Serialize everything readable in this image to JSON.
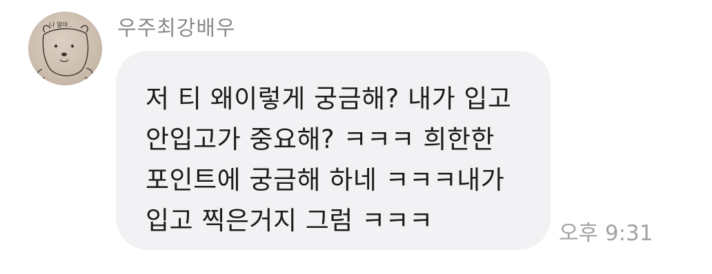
{
  "message": {
    "sender_name": "우주최강배우",
    "avatar": "bear-doodle-avatar",
    "avatar_sketch_text": "나 알아..",
    "lines": [
      "저 티 왜이렇게 궁금해? 내가 입고",
      "안입고가 중요해? ㅋㅋㅋ 희한한",
      "포인트에 궁금해 하네 ㅋㅋㅋ내가",
      "입고 찍은거지 그럼 ㅋㅋㅋ"
    ],
    "timestamp": "오후 9:31"
  },
  "colors": {
    "background": "#ffffff",
    "bubble": "#f2f2f4",
    "text": "#1b1b1b",
    "name": "#8a8a8e",
    "timestamp": "#a3a3a7"
  }
}
